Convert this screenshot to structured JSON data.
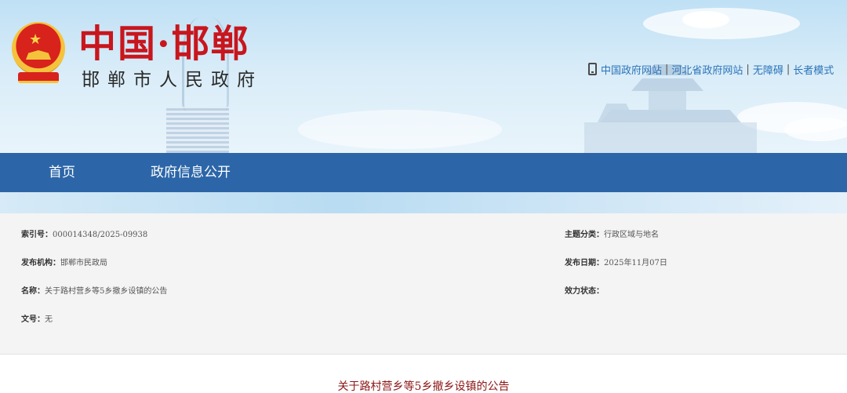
{
  "header": {
    "site_title": "中国·邯郸",
    "site_subtitle": "邯郸市人民政府",
    "top_links": [
      {
        "label": "中国政府网站"
      },
      {
        "label": "河北省政府网站"
      },
      {
        "label": "无障碍"
      },
      {
        "label": "长者模式"
      }
    ],
    "separator": "|"
  },
  "nav": {
    "items": [
      {
        "label": "首页"
      },
      {
        "label": "政府信息公开"
      }
    ],
    "color": "#2c66a8"
  },
  "meta": {
    "index_no": {
      "label": "索引号：",
      "value": "000014348/2025-09938"
    },
    "topic": {
      "label": "主题分类：",
      "value": "行政区域与地名"
    },
    "publisher": {
      "label": "发布机构：",
      "value": "邯郸市民政局"
    },
    "publish_date": {
      "label": "发布日期：",
      "value": "2025年11月07日"
    },
    "name": {
      "label": "名称：",
      "value": "关于路村营乡等5乡撤乡设镇的公告"
    },
    "status": {
      "label": "效力状态：",
      "value": ""
    },
    "doc_no": {
      "label": "文号：",
      "value": "无"
    }
  },
  "article": {
    "title": "关于路村营乡等5乡撤乡设镇的公告",
    "title_color": "#8c1414"
  }
}
